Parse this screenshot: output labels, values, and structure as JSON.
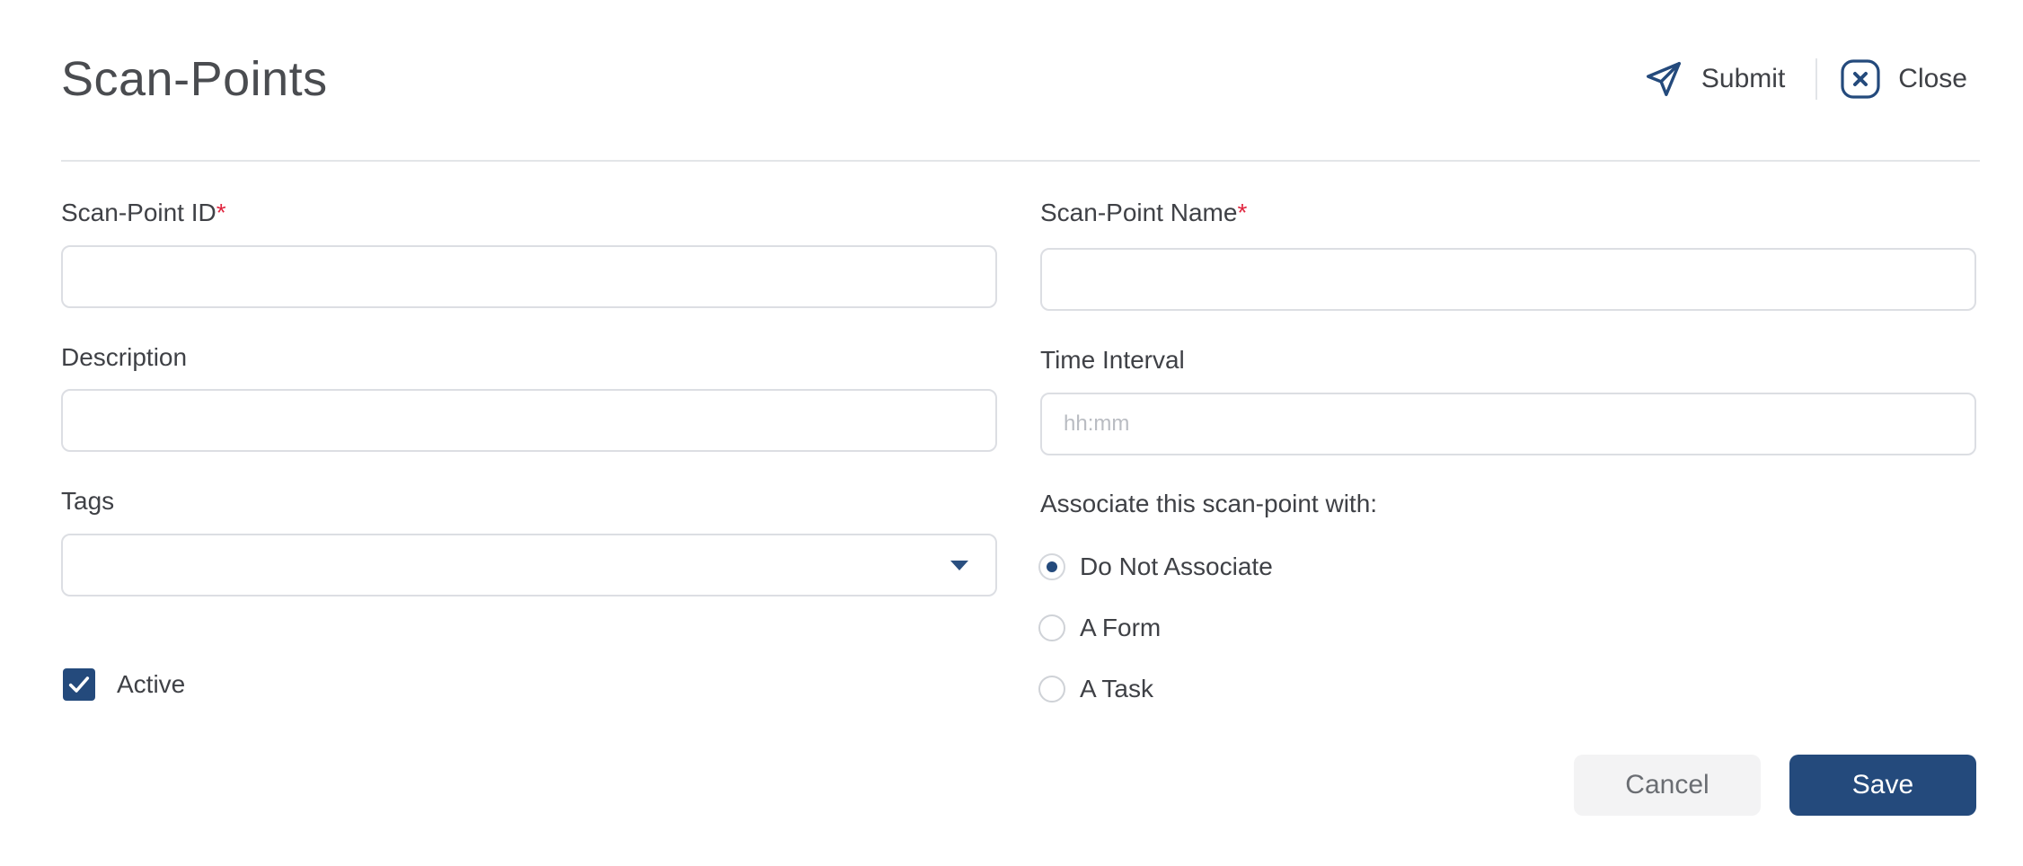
{
  "header": {
    "title": "Scan-Points",
    "submit_label": "Submit",
    "close_label": "Close"
  },
  "form": {
    "scan_point_id": {
      "label": "Scan-Point ID",
      "required_mark": "*",
      "value": ""
    },
    "scan_point_name": {
      "label": "Scan-Point Name",
      "required_mark": "*",
      "value": ""
    },
    "description": {
      "label": "Description",
      "value": ""
    },
    "time_interval": {
      "label": "Time Interval",
      "placeholder": "hh:mm",
      "value": ""
    },
    "tags": {
      "label": "Tags",
      "value": ""
    },
    "active": {
      "label": "Active",
      "checked": true
    },
    "associate": {
      "label": "Associate this scan-point with:",
      "options": [
        {
          "label": "Do Not Associate",
          "selected": true
        },
        {
          "label": "A Form",
          "selected": false
        },
        {
          "label": "A Task",
          "selected": false
        }
      ]
    }
  },
  "footer": {
    "cancel_label": "Cancel",
    "save_label": "Save"
  },
  "colors": {
    "primary": "#244a7c",
    "required": "#e0253f",
    "border": "#dcdee3"
  }
}
